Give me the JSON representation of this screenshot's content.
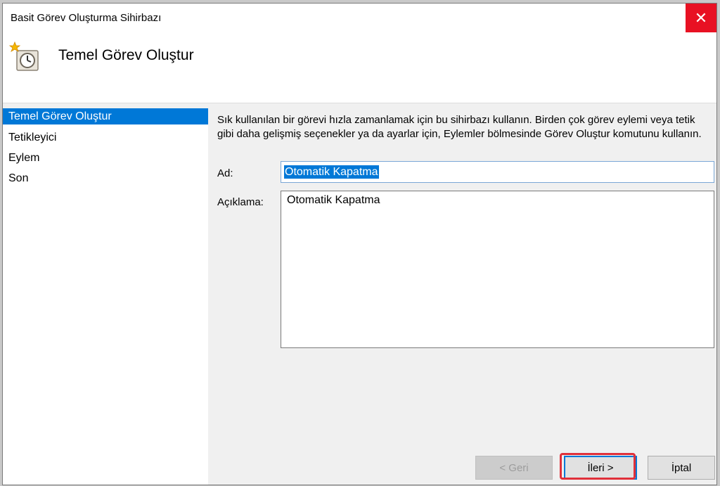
{
  "window": {
    "title": "Basit Görev Oluşturma Sihirbazı",
    "close_glyph": "✕"
  },
  "header": {
    "title": "Temel Görev Oluştur",
    "icon": "task-scheduler-icon"
  },
  "steps": [
    {
      "label": "Temel Görev Oluştur",
      "active": true
    },
    {
      "label": "Tetikleyici",
      "active": false
    },
    {
      "label": "Eylem",
      "active": false
    },
    {
      "label": "Son",
      "active": false
    }
  ],
  "content": {
    "description": "Sık kullanılan bir görevi hızla zamanlamak için bu sihirbazı kullanın. Birden çok görev eylemi veya tetik gibi daha gelişmiş seçenekler ya da ayarlar için, Eylemler bölmesinde Görev Oluştur komutunu kullanın.",
    "name_label": "Ad:",
    "name_value": "Otomatik Kapatma",
    "description_label": "Açıklama:",
    "description_value": "Otomatik Kapatma"
  },
  "buttons": {
    "back": "< Geri",
    "next": "İleri >",
    "cancel": "İptal"
  },
  "colors": {
    "accent": "#0078d7",
    "close": "#e81123",
    "highlight": "#e0303a"
  }
}
